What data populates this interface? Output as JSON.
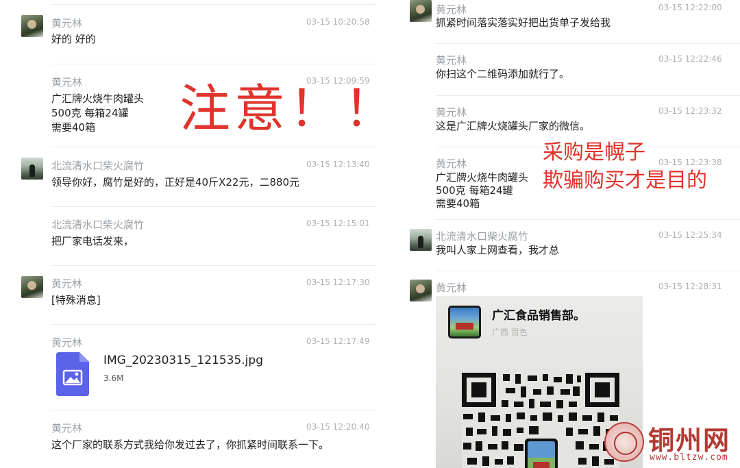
{
  "left": {
    "messages": [
      {
        "name": "黄元林",
        "time": "03-15 10:20:58",
        "lines": [
          "好的 好的"
        ],
        "avatar": "soldier-avatar"
      },
      {
        "name": "黄元林",
        "time": "03-15 12:09:59",
        "lines": [
          "广汇牌火烧牛肉罐头",
          "500克 每箱24罐",
          "需要40箱"
        ]
      },
      {
        "name": "北流清水口柴火腐竹",
        "time": "03-15 12:13:40",
        "lines": [
          "领导你好，腐竹是好的，正好是40斤X22元，二880元"
        ],
        "avatar": "road-avatar"
      },
      {
        "name": "北流清水口柴火腐竹",
        "time": "03-15 12:15:01",
        "lines": [
          "把厂家电话发来，"
        ]
      },
      {
        "name": "黄元林",
        "time": "03-15 12:17:30",
        "lines": [
          "[特殊消息]"
        ],
        "avatar": "soldier-avatar"
      },
      {
        "name": "黄元林",
        "time": "03-15 12:17:49",
        "file": {
          "name": "IMG_20230315_121535.jpg",
          "size": "3.6M"
        }
      },
      {
        "name": "黄元林",
        "time": "03-15 12:20:40",
        "lines": [
          "这个厂家的联系方式我给你发过去了，你抓紧时间联系一下。"
        ]
      }
    ],
    "overlay": "注意！！"
  },
  "right": {
    "messages": [
      {
        "name": "黄元林",
        "time": "03-15 12:22:00",
        "lines": [
          "抓紧时间落实落实好把出货单子发给我"
        ],
        "avatar": "soldier-avatar"
      },
      {
        "name": "黄元林",
        "time": "03-15 12:22:46",
        "lines": [
          "你扫这个二维码添加就行了。"
        ]
      },
      {
        "name": "黄元林",
        "time": "03-15 12:23:32",
        "lines": [
          "这是广汇牌火烧罐头厂家的微信。"
        ]
      },
      {
        "name": "黄元林",
        "time": "03-15 12:23:38",
        "lines": [
          "广汇牌火烧牛肉罐头",
          "500克 每箱24罐",
          "需要40箱"
        ]
      },
      {
        "name": "北流清水口柴火腐竹",
        "time": "03-15 12:25:34",
        "lines": [
          "我叫人家上网查看，我才总"
        ],
        "avatar": "road-avatar"
      },
      {
        "name": "黄元林",
        "time": "03-15 12:28:31",
        "avatar": "soldier-avatar"
      }
    ],
    "overlay": [
      "采购是幌子",
      "欺骗购买才是目的"
    ],
    "qr_card": {
      "title": "广汇食品销售部。",
      "subtitle": "广西 百色"
    }
  },
  "watermark": {
    "text": "铜州网",
    "url": "www.bltzw.com"
  },
  "colors": {
    "overlay_red": "#e0332b",
    "name_gray": "#9aa0a6",
    "file_icon": "#5b63e8"
  }
}
